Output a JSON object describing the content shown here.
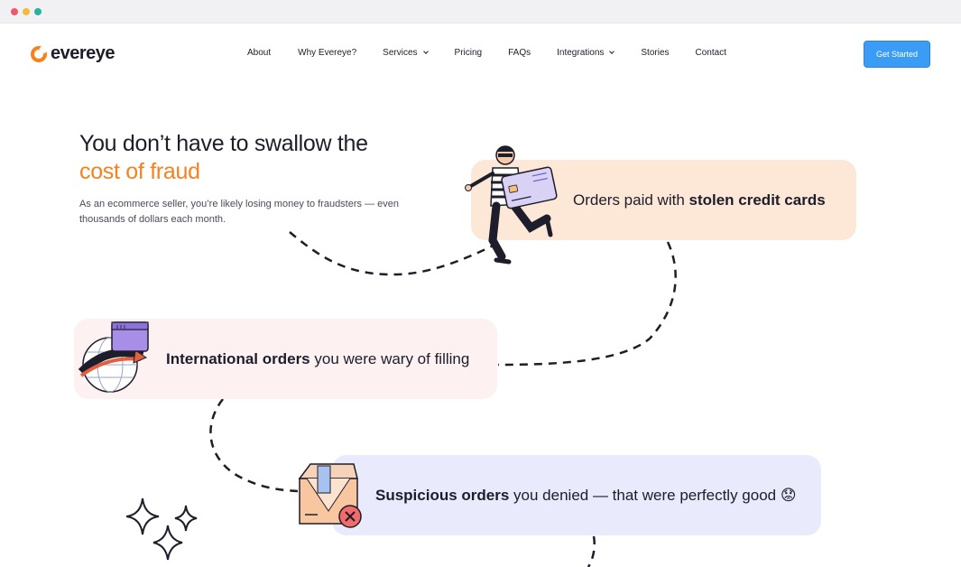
{
  "nav": {
    "brand": "evereye",
    "links": [
      {
        "label": "About"
      },
      {
        "label": "Why Evereye?"
      },
      {
        "label": "Services"
      },
      {
        "label": "Pricing"
      },
      {
        "label": "FAQs"
      },
      {
        "label": "Integrations"
      },
      {
        "label": "Stories"
      },
      {
        "label": "Contact"
      }
    ],
    "cta_label": "Get Started"
  },
  "hero": {
    "title_line1": "You don’t have to swallow the",
    "title_accent": "cost of fraud",
    "description": "As an ecommerce seller, you’re likely losing money to fraudsters — even thousands of dollars each month."
  },
  "cards": [
    {
      "prefix": "Orders paid with ",
      "bold": "stolen credit cards",
      "suffix": ""
    },
    {
      "prefix": "",
      "bold": "International orders",
      "suffix": " you were wary of filling"
    },
    {
      "prefix": "",
      "bold": "Suspicious orders",
      "suffix": " you denied — that were perfectly good 😟"
    }
  ],
  "colors": {
    "accent": "#f5821f",
    "cta": "#3b9cf5",
    "card1_bg": "#fde7d6",
    "card2_bg": "#fdf1f2",
    "card3_bg": "#e9eafb"
  }
}
